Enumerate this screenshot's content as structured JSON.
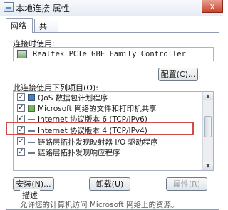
{
  "window": {
    "title": "本地连接 属性",
    "close_symbol": "x"
  },
  "tabs": [
    {
      "label": "网络",
      "active": true
    },
    {
      "label": "共享",
      "active": false
    }
  ],
  "connect_using": {
    "label": "连接时使用:",
    "adapter": "Realtek PCIe GBE Family Controller"
  },
  "buttons": {
    "configure": "配置(C)...",
    "install": "安装(N)...",
    "uninstall": "卸载(U)",
    "properties": "属性(R)"
  },
  "items_label": "此连接使用下列项目(O):",
  "items": [
    {
      "label": "QoS 数据包计划程序",
      "checked": true,
      "icon": "qos-icon"
    },
    {
      "label": "Microsoft 网络的文件和打印机共享",
      "checked": true,
      "icon": "client-icon"
    },
    {
      "label": "Internet 协议版本 6 (TCP/IPv6)",
      "checked": true,
      "icon": "protocol-icon"
    },
    {
      "label": "Internet 协议版本 4 (TCP/IPv4)",
      "checked": true,
      "icon": "protocol-icon"
    },
    {
      "label": "链路层拓扑发现映射器 I/O 驱动程序",
      "checked": true,
      "icon": "protocol-icon"
    },
    {
      "label": "链路层拓扑发现响应程序",
      "checked": true,
      "icon": "protocol-icon"
    }
  ],
  "description": {
    "title": "描述",
    "text": "允许您的计算机访问 Microsoft 网络上的资源。"
  },
  "colors": {
    "highlight_border": "#d24b4b"
  }
}
